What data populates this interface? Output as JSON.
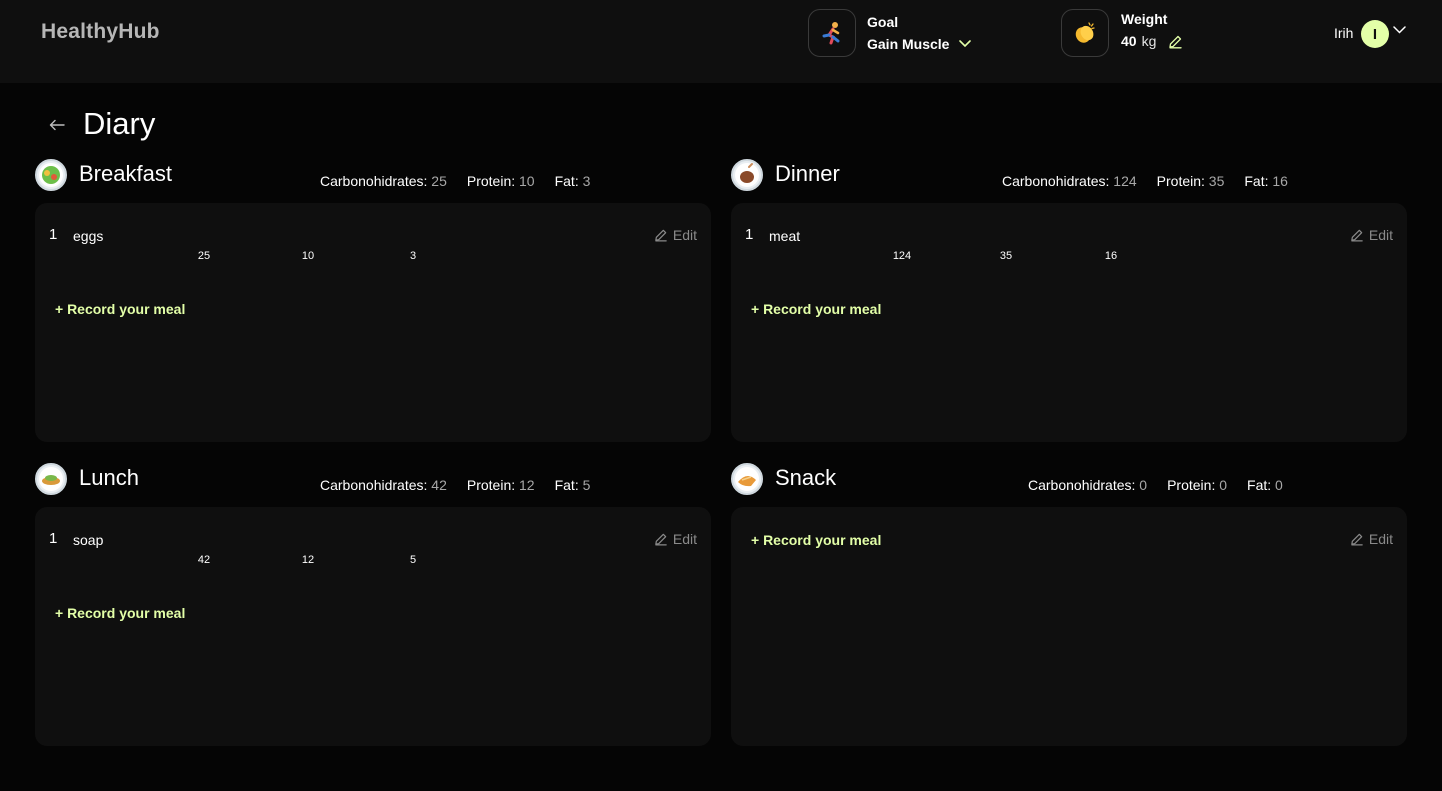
{
  "app": {
    "title": "HealthyHub"
  },
  "header": {
    "goal": {
      "title": "Goal",
      "value": "Gain Muscle",
      "icon": "running-person-icon"
    },
    "weight": {
      "title": "Weight",
      "value": "40",
      "unit": "kg",
      "icon": "clapping-hands-icon"
    },
    "user": {
      "name": "Irih",
      "initial": "I"
    }
  },
  "page": {
    "title": "Diary"
  },
  "labels": {
    "carbs": "Carbonohidrates:",
    "protein": "Protein:",
    "fat": "Fat:",
    "edit": "Edit",
    "record": "+ Record your meal"
  },
  "meals": {
    "breakfast": {
      "name": "Breakfast",
      "totals": {
        "carbs": "25",
        "protein": "10",
        "fat": "3"
      },
      "entries": [
        {
          "index": "1",
          "name": "eggs",
          "carbs": "25",
          "protein": "10",
          "fat": "3"
        }
      ]
    },
    "dinner": {
      "name": "Dinner",
      "totals": {
        "carbs": "124",
        "protein": "35",
        "fat": "16"
      },
      "entries": [
        {
          "index": "1",
          "name": "meat",
          "carbs": "124",
          "protein": "35",
          "fat": "16"
        }
      ]
    },
    "lunch": {
      "name": "Lunch",
      "totals": {
        "carbs": "42",
        "protein": "12",
        "fat": "5"
      },
      "entries": [
        {
          "index": "1",
          "name": "soap",
          "carbs": "42",
          "protein": "12",
          "fat": "5"
        }
      ]
    },
    "snack": {
      "name": "Snack",
      "totals": {
        "carbs": "0",
        "protein": "0",
        "fat": "0"
      },
      "entries": []
    }
  },
  "colors": {
    "accent": "#e3ffa8",
    "background": "#050505",
    "card": "#0f0f0f",
    "muted": "#a8a8a8"
  }
}
